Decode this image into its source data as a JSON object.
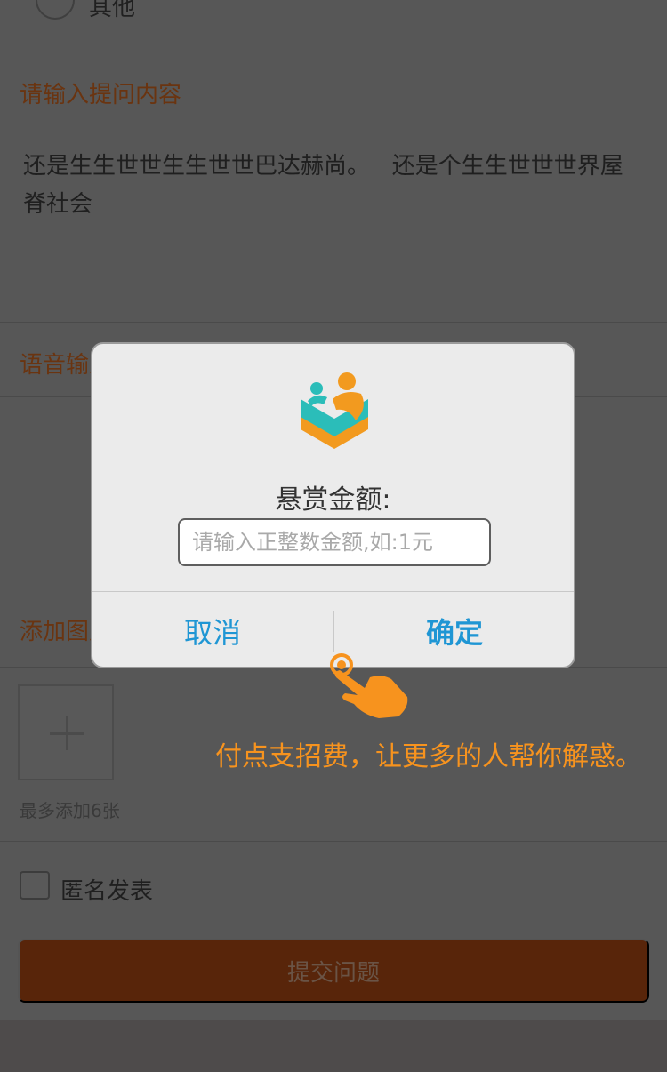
{
  "page": {
    "radio_option_label": "其他",
    "question_section_title": "请输入提问内容",
    "question_text": "还是生生世世生生世世巴达赫尚。   还是个生生世世世界屋脊社会",
    "voice_section_title": "语音输入",
    "image_section_title": "添加图片",
    "image_limit_hint": "最多添加6张",
    "anonymous_label": "匿名发表",
    "submit_label": "提交问题"
  },
  "dialog": {
    "title": "悬赏金额:",
    "amount_placeholder": "请输入正整数金额,如:1元",
    "amount_value": "",
    "cancel_label": "取消",
    "confirm_label": "确定"
  },
  "tip": {
    "text": "付点支招费，让更多的人帮你解惑。"
  },
  "colors": {
    "accent_orange": "#f7931e",
    "dialog_button_blue": "#1f96d4",
    "submit_brown": "#58250a",
    "logo_teal": "#2bbdb9"
  }
}
